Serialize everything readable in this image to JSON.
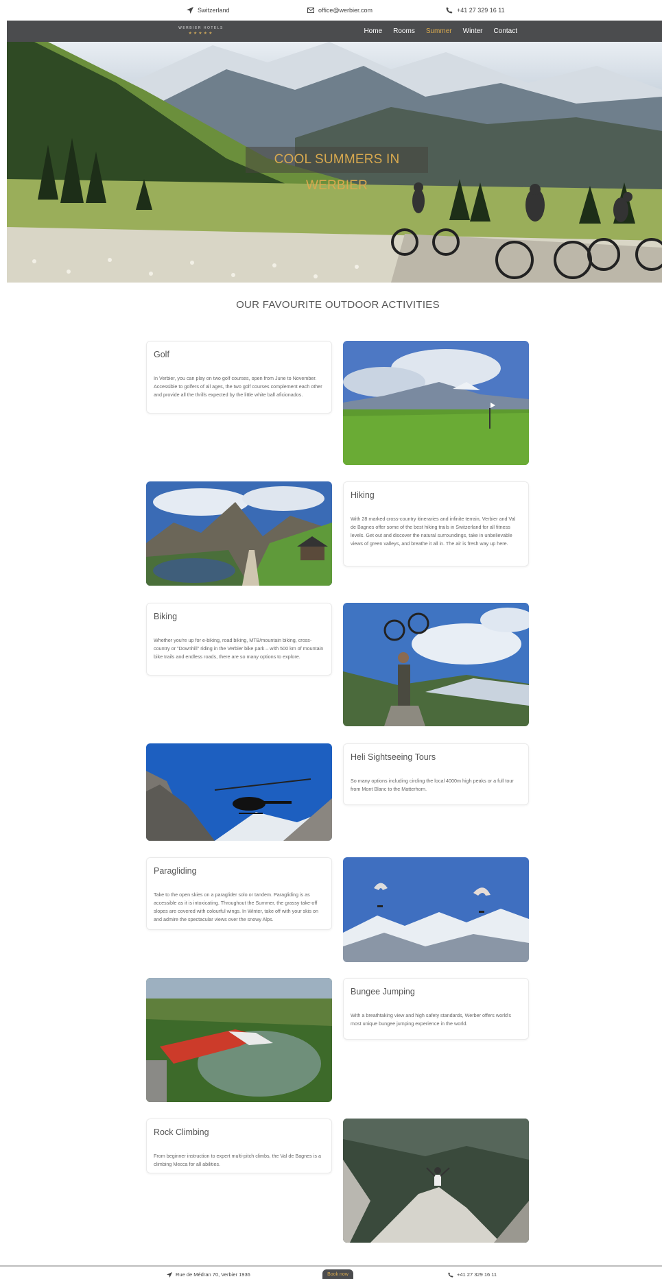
{
  "topbar": {
    "location": "Switzerland",
    "email": "office@werbier.com",
    "phone": "+41 27 329 16 11"
  },
  "nav": {
    "logo_name": "WERBIER HOTELS",
    "logo_stars": "★★★★★",
    "items": [
      "Home",
      "Rooms",
      "Summer",
      "Winter",
      "Contact"
    ],
    "active": "Summer",
    "accent_color": "#d8a94f"
  },
  "hero": {
    "title": "COOL SUMMERS IN WERBIER"
  },
  "section_title": "OUR FAVOURITE OUTDOOR ACTIVITIES",
  "activities": [
    {
      "title": "Golf",
      "text": "In Verbier, you can play on two golf courses, open from June to November. Accessible to golfers of all ages, the two golf courses complement each other and provide all the thrills expected by the little white ball aficionados.",
      "image": "golf-course-photo"
    },
    {
      "title": "Hiking",
      "text": "With 28 marked cross-country itineraries and infinite terrain, Verbier and Val de Bagnes offer some of the best hiking trails in Switzerland for all fitness levels. Get out and discover the natural surroundings, take in unbelievable views of green valleys, and breathe it all in. The air is fresh way up here.",
      "image": "hiking-trail-photo"
    },
    {
      "title": "Biking",
      "text": "Whether you're up for e-biking, road biking, MTB/mountain biking, cross-country or \"Downhill\" riding in the Verbier bike park – with 500 km of mountain bike trails and endless roads, there are so many options to explore.",
      "image": "mountain-biker-photo"
    },
    {
      "title": "Heli Sightseeing Tours",
      "text": "So many options including circling the local 4000m high peaks or a full tour from Mont Blanc to the Matterhorn.",
      "image": "helicopter-photo"
    },
    {
      "title": "Paragliding",
      "text": "Take to the open skies on a paraglider solo or tandem. Paragliding is as accessible as it is intoxicating. Throughout the Summer, the grassy take-off slopes are covered with colourful wings. In Winter, take off with your skis on and admire the spectacular views over the snowy Alps.",
      "image": "paragliders-photo"
    },
    {
      "title": "Bungee Jumping",
      "text": "With a breathtaking view and high safety standards, Werber offers world's most unique bungee jumping experience in the world.",
      "image": "bungee-jump-photo"
    },
    {
      "title": "Rock Climbing",
      "text": "From beginner instruction to expert multi-pitch climbs, the Val de Bagnes is a climbing Mecca for all abilities.",
      "image": "rock-climber-photo"
    }
  ],
  "footer": {
    "address": "Rue de Médran 70, Verbier 1936",
    "book_label": "Book now",
    "phone": "+41 27 329 16 11"
  }
}
